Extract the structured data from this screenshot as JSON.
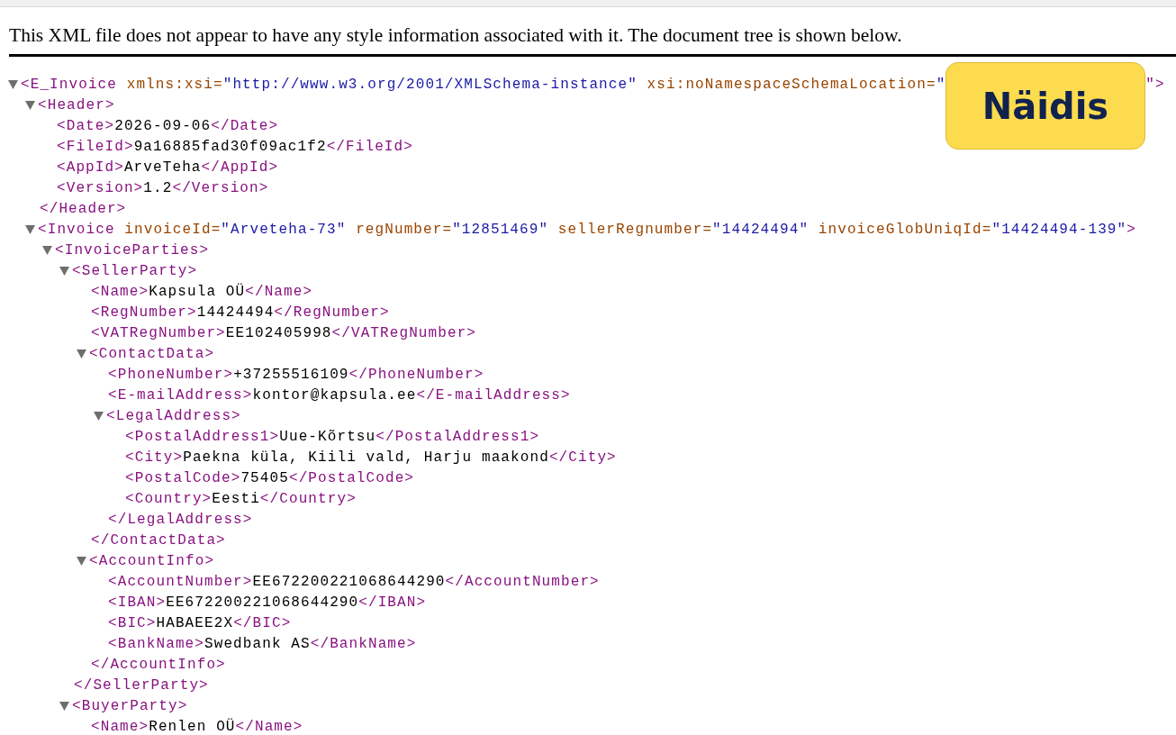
{
  "notice": "This XML file does not appear to have any style information associated with it. The document tree is shown below.",
  "badge": "Näidis",
  "tree": [
    {
      "open": "<E_Invoice",
      "attributes": [
        {
          "name": "xmlns:xsi=",
          "value": "\"http://www.w3.org/2001/XMLSchema-instance\"",
          "covered": false
        },
        {
          "name": "xsi:noNamespaceSchemaLocation=",
          "value": "\"",
          "covered": true
        }
      ],
      "open_end": "\">",
      "expanded": true,
      "children": [
        {
          "open": "<Header>",
          "expanded": true,
          "children": [
            {
              "open": "<Date>",
              "text": "2026-09-06",
              "close": "</Date>"
            },
            {
              "open": "<FileId>",
              "text": "9a16885fad30f09ac1f2",
              "close": "</FileId>"
            },
            {
              "open": "<AppId>",
              "text": "ArveTeha",
              "close": "</AppId>"
            },
            {
              "open": "<Version>",
              "text": "1.2",
              "close": "</Version>"
            }
          ],
          "close": "</Header>"
        },
        {
          "open": "<Invoice",
          "attributes": [
            {
              "name": "invoiceId=",
              "value": "\"Arveteha-73\"",
              "covered": false
            },
            {
              "name": "regNumber=",
              "value": "\"12851469\"",
              "covered": false
            },
            {
              "name": "sellerRegnumber=",
              "value": "\"14424494\"",
              "covered": false
            },
            {
              "name": "invoiceGlobUniqId=",
              "value": "\"14424494-139\"",
              "covered": false
            }
          ],
          "open_end": ">",
          "expanded": true,
          "children": [
            {
              "open": "<InvoiceParties>",
              "expanded": true,
              "children": [
                {
                  "open": "<SellerParty>",
                  "expanded": true,
                  "children": [
                    {
                      "open": "<Name>",
                      "text": "Kapsula OÜ",
                      "close": "</Name>"
                    },
                    {
                      "open": "<RegNumber>",
                      "text": "14424494",
                      "close": "</RegNumber>"
                    },
                    {
                      "open": "<VATRegNumber>",
                      "text": "EE102405998",
                      "close": "</VATRegNumber>"
                    },
                    {
                      "open": "<ContactData>",
                      "expanded": true,
                      "children": [
                        {
                          "open": "<PhoneNumber>",
                          "text": "+37255516109",
                          "close": "</PhoneNumber>"
                        },
                        {
                          "open": "<E-mailAddress>",
                          "text": "kontor@kapsula.ee",
                          "close": "</E-mailAddress>"
                        },
                        {
                          "open": "<LegalAddress>",
                          "expanded": true,
                          "children": [
                            {
                              "open": "<PostalAddress1>",
                              "text": "Uue-Kõrtsu",
                              "close": "</PostalAddress1>"
                            },
                            {
                              "open": "<City>",
                              "text": "Paekna küla, Kiili vald, Harju maakond",
                              "close": "</City>"
                            },
                            {
                              "open": "<PostalCode>",
                              "text": "75405",
                              "close": "</PostalCode>"
                            },
                            {
                              "open": "<Country>",
                              "text": "Eesti",
                              "close": "</Country>"
                            }
                          ],
                          "close": "</LegalAddress>"
                        }
                      ],
                      "close": "</ContactData>"
                    },
                    {
                      "open": "<AccountInfo>",
                      "expanded": true,
                      "children": [
                        {
                          "open": "<AccountNumber>",
                          "text": "EE672200221068644290",
                          "close": "</AccountNumber>"
                        },
                        {
                          "open": "<IBAN>",
                          "text": "EE672200221068644290",
                          "close": "</IBAN>"
                        },
                        {
                          "open": "<BIC>",
                          "text": "HABAEE2X",
                          "close": "</BIC>"
                        },
                        {
                          "open": "<BankName>",
                          "text": "Swedbank AS",
                          "close": "</BankName>"
                        }
                      ],
                      "close": "</AccountInfo>"
                    }
                  ],
                  "close": "</SellerParty>"
                },
                {
                  "open": "<BuyerParty>",
                  "expanded": true,
                  "children": [
                    {
                      "open": "<Name>",
                      "text": "Renlen OÜ",
                      "close": "</Name>"
                    }
                  ]
                }
              ]
            }
          ]
        }
      ]
    }
  ]
}
